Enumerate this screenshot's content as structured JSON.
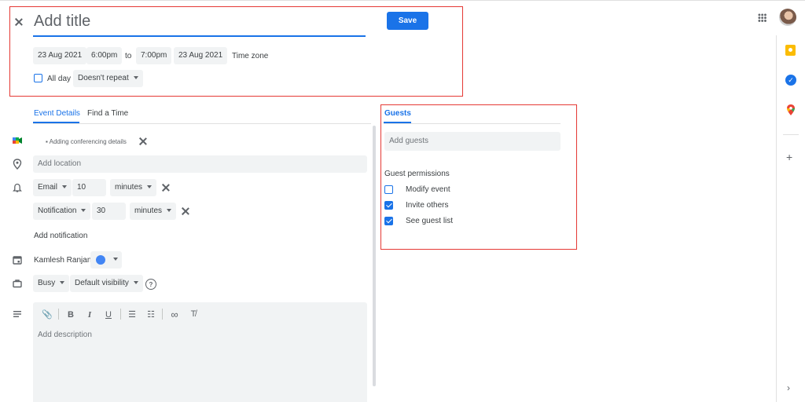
{
  "header": {
    "title_placeholder": "Add title",
    "save_label": "Save",
    "start_date": "23 Aug 2021",
    "start_time": "6:00pm",
    "to_label": "to",
    "end_time": "7:00pm",
    "end_date": "23 Aug 2021",
    "timezone_label": "Time zone",
    "allday_label": "All day",
    "repeat_label": "Doesn't repeat"
  },
  "tabs": {
    "details": "Event Details",
    "find_time": "Find a Time",
    "guests": "Guests"
  },
  "details": {
    "conferencing": "Adding conferencing details",
    "location_placeholder": "Add location",
    "notif1_type": "Email",
    "notif1_value": "10",
    "notif1_unit": "minutes",
    "notif2_type": "Notification",
    "notif2_value": "30",
    "notif2_unit": "minutes",
    "add_notification": "Add notification",
    "calendar_owner": "Kamlesh Ranjan",
    "calendar_color": "#4285f4",
    "busy": "Busy",
    "visibility": "Default visibility",
    "description_placeholder": "Add description"
  },
  "guests": {
    "add_placeholder": "Add guests",
    "permissions_title": "Guest permissions",
    "permissions": [
      {
        "label": "Modify event",
        "checked": false
      },
      {
        "label": "Invite others",
        "checked": true
      },
      {
        "label": "See guest list",
        "checked": true
      }
    ]
  },
  "colors": {
    "accent": "#1a73e8",
    "highlight": "#e53935"
  }
}
